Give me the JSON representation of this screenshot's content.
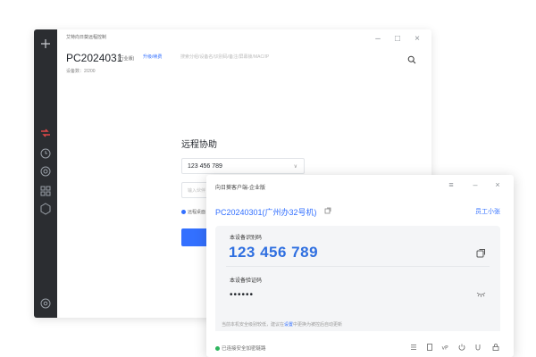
{
  "main_window": {
    "app_title": "艾特向日葵远程控制",
    "device_name": "PC2024031",
    "edition": "(行业版)",
    "upgrade_link": "升级/续费",
    "device_count": "设备数：2/200",
    "search_placeholder": "搜索分组/设备名/识别码/备注/屏幕锁/MAC/IP",
    "remote_assist": {
      "title": "远程协助",
      "device_id": "123 456 789",
      "code_placeholder": "输入伙伴",
      "radio_label": "远程桌面"
    }
  },
  "client_window": {
    "title": "向日葵客户端-企业版",
    "device": "PC20240301(广州办32号机)",
    "staff_link": "员工小张",
    "id_label": "本设备识别码",
    "id_value": "123 456 789",
    "pw_label": "本设备验证码",
    "pw_value": "••••••",
    "tip_prefix": "当前本机安全级别较低，建议在",
    "tip_link": "设置",
    "tip_suffix": "中更换为被控后自动更新",
    "status": "已连接安全加密链路"
  },
  "colors": {
    "accent": "#3370ff",
    "sidebar": "#2b2d31",
    "online": "#2db55d",
    "panel": "#f4f5f7"
  }
}
